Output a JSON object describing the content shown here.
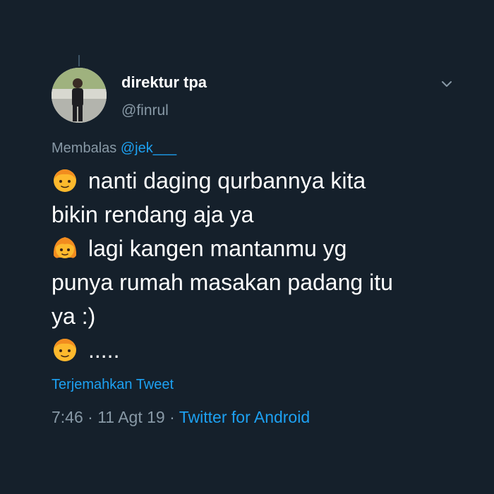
{
  "tweet": {
    "display_name": "direktur tpa",
    "handle": "@finrul",
    "reply_prefix": "Membalas",
    "reply_to": "@jek___",
    "lines": [
      "nanti daging qurbannya kita",
      "bikin rendang aja ya",
      "lagi kangen mantanmu yg",
      "punya rumah masakan padang itu",
      "ya :)",
      "....."
    ],
    "emoji_icons": [
      "boy-face-icon",
      "girl-face-icon",
      "boy-face-icon"
    ],
    "translate_label": "Terjemahkan Tweet",
    "time": "7:46",
    "date": "11 Agt 19",
    "separator": "·",
    "source": "Twitter for Android"
  },
  "colors": {
    "background": "#15202b",
    "primary_text": "#ffffff",
    "secondary_text": "#8899a6",
    "accent": "#1da1f2"
  }
}
